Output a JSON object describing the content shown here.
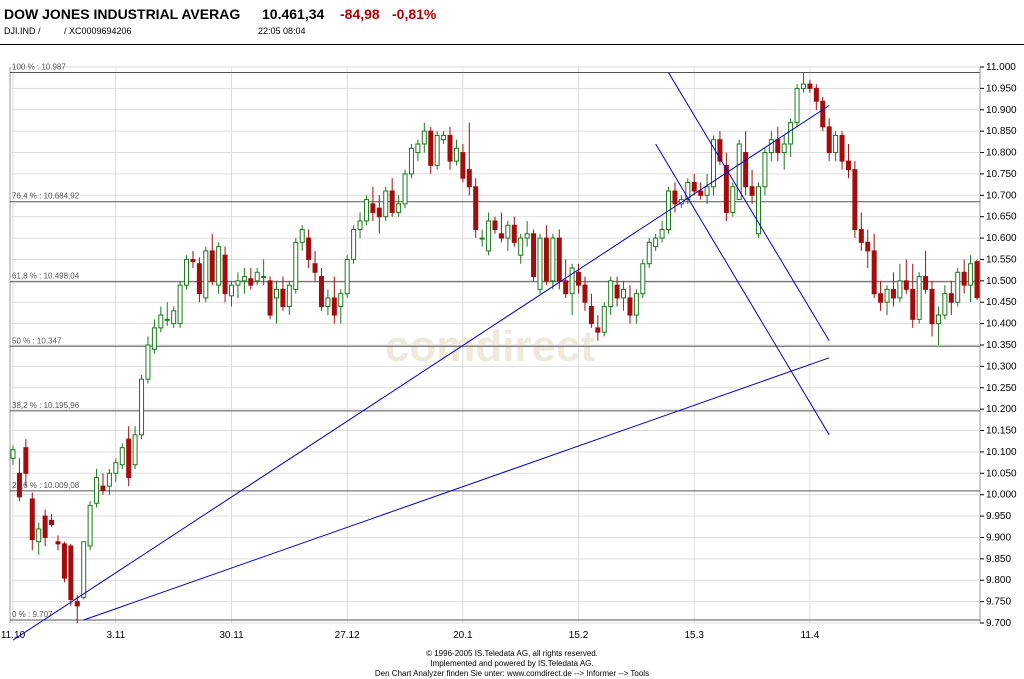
{
  "header": {
    "name": "DOW JONES INDUSTRIAL AVERAG",
    "price": "10.461,34",
    "change": "-84,98",
    "change_pct": "-0,81%",
    "symbol": "DJI.IND  /",
    "isin": "/  XC0009694206",
    "time": "22:05   08:04"
  },
  "watermark": "comdirect",
  "footer": {
    "line1": "© 1996-2005 IS.Teledata AG, all rights reserved.",
    "line2": "Implemented and powered by IS.Teledata AG.",
    "line3": "Den Chart Analyzer finden Sie unter: www.comdirect.de --> Informer --> Tools"
  },
  "colors": {
    "up": "#1a7a1a",
    "down": "#a30d0d",
    "trendline": "#0000cc",
    "grid": "#dddddd",
    "change": "#b00000"
  },
  "chart_data": {
    "type": "candlestick",
    "title": "",
    "ylim": [
      9700,
      11000
    ],
    "y_ticks": [
      "11.000",
      "10.950",
      "10.900",
      "10.850",
      "10.800",
      "10.750",
      "10.700",
      "10.650",
      "10.600",
      "10.550",
      "10.500",
      "10.450",
      "10.400",
      "10.350",
      "10.300",
      "10.250",
      "10.200",
      "10.150",
      "10.100",
      "10.050",
      "10.000",
      "9.950",
      "9.900",
      "9.850",
      "9.800",
      "9.750",
      "9.700"
    ],
    "x_ticks": [
      {
        "label": "11.10",
        "index": 0
      },
      {
        "label": "3.11",
        "index": 16
      },
      {
        "label": "30.11",
        "index": 34
      },
      {
        "label": "27.12",
        "index": 52
      },
      {
        "label": "20.1",
        "index": 70
      },
      {
        "label": "15.2",
        "index": 88
      },
      {
        "label": "15.3",
        "index": 106
      },
      {
        "label": "11.4",
        "index": 124
      }
    ],
    "fibonacci": [
      {
        "label": "100 % : 10.987",
        "value": 10987
      },
      {
        "label": "76,4 % : 10.684,92",
        "value": 10685
      },
      {
        "label": "61,8 % : 10.498,04",
        "value": 10498
      },
      {
        "label": "50 % : 10.347",
        "value": 10347
      },
      {
        "label": "38,2 % : 10.195,96",
        "value": 10196
      },
      {
        "label": "23,6 % : 10.009,08",
        "value": 10009
      },
      {
        "label": "0 % : 9.707",
        "value": 9707
      }
    ],
    "trendlines": [
      {
        "x1": 0.0,
        "y1": 9660,
        "x2": 127.0,
        "y2": 10910
      },
      {
        "x1": 11.0,
        "y1": 9707,
        "x2": 127.0,
        "y2": 10320
      },
      {
        "x1": 102.0,
        "y1": 10987,
        "x2": 127.0,
        "y2": 10360
      },
      {
        "x1": 100.0,
        "y1": 10820,
        "x2": 127.0,
        "y2": 10140
      }
    ],
    "candles": [
      [
        10085,
        10115,
        10070,
        10105
      ],
      [
        10050,
        10085,
        9985,
        9995
      ],
      [
        10110,
        10130,
        10020,
        10050
      ],
      [
        9990,
        10005,
        9870,
        9895
      ],
      [
        9890,
        9935,
        9860,
        9920
      ],
      [
        9950,
        9965,
        9880,
        9900
      ],
      [
        9940,
        9955,
        9925,
        9930
      ],
      [
        9890,
        9905,
        9870,
        9885
      ],
      [
        9885,
        9890,
        9795,
        9805
      ],
      [
        9880,
        9885,
        9740,
        9755
      ],
      [
        9750,
        9765,
        9700,
        9740
      ],
      [
        9760,
        9890,
        9755,
        9890
      ],
      [
        9880,
        9985,
        9870,
        9975
      ],
      [
        9980,
        10060,
        9970,
        10040
      ],
      [
        10020,
        10050,
        10000,
        10010
      ],
      [
        10020,
        10060,
        10000,
        10050
      ],
      [
        10050,
        10085,
        10030,
        10075
      ],
      [
        10070,
        10120,
        10060,
        10110
      ],
      [
        10130,
        10160,
        10020,
        10040
      ],
      [
        10070,
        10160,
        10060,
        10140
      ],
      [
        10140,
        10280,
        10130,
        10270
      ],
      [
        10270,
        10370,
        10260,
        10350
      ],
      [
        10340,
        10410,
        10330,
        10390
      ],
      [
        10390,
        10440,
        10380,
        10420
      ],
      [
        10410,
        10450,
        10395,
        10410
      ],
      [
        10400,
        10440,
        10390,
        10430
      ],
      [
        10400,
        10500,
        10390,
        10490
      ],
      [
        10490,
        10560,
        10480,
        10550
      ],
      [
        10550,
        10570,
        10530,
        10545
      ],
      [
        10540,
        10555,
        10450,
        10470
      ],
      [
        10460,
        10580,
        10450,
        10570
      ],
      [
        10570,
        10610,
        10490,
        10500
      ],
      [
        10490,
        10590,
        10470,
        10580
      ],
      [
        10560,
        10580,
        10450,
        10470
      ],
      [
        10465,
        10500,
        10440,
        10490
      ],
      [
        10490,
        10520,
        10460,
        10500
      ],
      [
        10500,
        10530,
        10470,
        10510
      ],
      [
        10505,
        10530,
        10480,
        10490
      ],
      [
        10500,
        10530,
        10490,
        10520
      ],
      [
        10510,
        10550,
        10490,
        10510
      ],
      [
        10500,
        10510,
        10410,
        10420
      ],
      [
        10460,
        10500,
        10400,
        10480
      ],
      [
        10480,
        10510,
        10430,
        10440
      ],
      [
        10440,
        10500,
        10420,
        10490
      ],
      [
        10480,
        10600,
        10470,
        10590
      ],
      [
        10590,
        10630,
        10570,
        10620
      ],
      [
        10600,
        10620,
        10530,
        10550
      ],
      [
        10540,
        10570,
        10500,
        10520
      ],
      [
        10510,
        10530,
        10430,
        10440
      ],
      [
        10440,
        10480,
        10420,
        10460
      ],
      [
        10460,
        10510,
        10400,
        10420
      ],
      [
        10440,
        10480,
        10400,
        10470
      ],
      [
        10470,
        10560,
        10460,
        10550
      ],
      [
        10550,
        10630,
        10540,
        10620
      ],
      [
        10620,
        10660,
        10600,
        10640
      ],
      [
        10640,
        10700,
        10630,
        10690
      ],
      [
        10680,
        10720,
        10640,
        10660
      ],
      [
        10670,
        10700,
        10610,
        10650
      ],
      [
        10650,
        10720,
        10640,
        10710
      ],
      [
        10710,
        10740,
        10650,
        10660
      ],
      [
        10660,
        10700,
        10650,
        10680
      ],
      [
        10680,
        10760,
        10670,
        10750
      ],
      [
        10750,
        10820,
        10740,
        10810
      ],
      [
        10800,
        10830,
        10780,
        10820
      ],
      [
        10820,
        10870,
        10800,
        10850
      ],
      [
        10850,
        10860,
        10750,
        10770
      ],
      [
        10770,
        10850,
        10760,
        10840
      ],
      [
        10830,
        10850,
        10820,
        10840
      ],
      [
        10840,
        10860,
        10760,
        10780
      ],
      [
        10780,
        10830,
        10770,
        10810
      ],
      [
        10800,
        10820,
        10730,
        10740
      ],
      [
        10760,
        10870,
        10700,
        10720
      ],
      [
        10720,
        10740,
        10600,
        10620
      ],
      [
        10600,
        10620,
        10580,
        10600
      ],
      [
        10570,
        10660,
        10560,
        10640
      ],
      [
        10640,
        10650,
        10610,
        10620
      ],
      [
        10610,
        10660,
        10590,
        10600
      ],
      [
        10600,
        10640,
        10570,
        10630
      ],
      [
        10630,
        10650,
        10580,
        10590
      ],
      [
        10560,
        10610,
        10540,
        10600
      ],
      [
        10600,
        10640,
        10580,
        10610
      ],
      [
        10610,
        10620,
        10500,
        10510
      ],
      [
        10480,
        10610,
        10470,
        10600
      ],
      [
        10600,
        10630,
        10490,
        10500
      ],
      [
        10500,
        10610,
        10480,
        10600
      ],
      [
        10600,
        10620,
        10480,
        10500
      ],
      [
        10500,
        10550,
        10460,
        10470
      ],
      [
        10470,
        10540,
        10420,
        10530
      ],
      [
        10520,
        10540,
        10470,
        10490
      ],
      [
        10490,
        10510,
        10430,
        10450
      ],
      [
        10440,
        10470,
        10390,
        10400
      ],
      [
        10390,
        10420,
        10360,
        10380
      ],
      [
        10380,
        10450,
        10370,
        10440
      ],
      [
        10440,
        10510,
        10420,
        10500
      ],
      [
        10490,
        10510,
        10440,
        10460
      ],
      [
        10460,
        10500,
        10430,
        10480
      ],
      [
        10460,
        10490,
        10400,
        10420
      ],
      [
        10420,
        10480,
        10400,
        10470
      ],
      [
        10470,
        10550,
        10460,
        10540
      ],
      [
        10540,
        10600,
        10530,
        10590
      ],
      [
        10580,
        10610,
        10570,
        10600
      ],
      [
        10600,
        10640,
        10590,
        10620
      ],
      [
        10620,
        10720,
        10610,
        10710
      ],
      [
        10710,
        10730,
        10660,
        10680
      ],
      [
        10680,
        10700,
        10670,
        10690
      ],
      [
        10690,
        10740,
        10680,
        10730
      ],
      [
        10730,
        10750,
        10700,
        10710
      ],
      [
        10710,
        10730,
        10690,
        10700
      ],
      [
        10700,
        10750,
        10680,
        10720
      ],
      [
        10720,
        10840,
        10700,
        10830
      ],
      [
        10830,
        10850,
        10770,
        10780
      ],
      [
        10770,
        10800,
        10640,
        10660
      ],
      [
        10660,
        10730,
        10650,
        10720
      ],
      [
        10690,
        10830,
        10690,
        10820
      ],
      [
        10800,
        10850,
        10700,
        10720
      ],
      [
        10720,
        10760,
        10680,
        10700
      ],
      [
        10610,
        10730,
        10600,
        10720
      ],
      [
        10720,
        10810,
        10700,
        10800
      ],
      [
        10800,
        10850,
        10780,
        10830
      ],
      [
        10830,
        10860,
        10780,
        10800
      ],
      [
        10800,
        10840,
        10760,
        10820
      ],
      [
        10820,
        10880,
        10790,
        10870
      ],
      [
        10870,
        10960,
        10860,
        10950
      ],
      [
        10950,
        10987,
        10940,
        10960
      ],
      [
        10960,
        10970,
        10940,
        10950
      ],
      [
        10950,
        10960,
        10900,
        10920
      ],
      [
        10920,
        10930,
        10850,
        10860
      ],
      [
        10860,
        10880,
        10780,
        10800
      ],
      [
        10800,
        10850,
        10780,
        10840
      ],
      [
        10840,
        10850,
        10760,
        10780
      ],
      [
        10780,
        10820,
        10740,
        10760
      ],
      [
        10760,
        10780,
        10600,
        10620
      ],
      [
        10620,
        10660,
        10570,
        10590
      ],
      [
        10590,
        10620,
        10530,
        10570
      ],
      [
        10570,
        10610,
        10460,
        10470
      ],
      [
        10470,
        10500,
        10430,
        10450
      ],
      [
        10450,
        10490,
        10420,
        10480
      ],
      [
        10480,
        10520,
        10440,
        10460
      ],
      [
        10460,
        10540,
        10450,
        10500
      ],
      [
        10500,
        10550,
        10470,
        10480
      ],
      [
        10480,
        10540,
        10390,
        10410
      ],
      [
        10410,
        10520,
        10400,
        10510
      ],
      [
        10510,
        10570,
        10470,
        10480
      ],
      [
        10480,
        10500,
        10370,
        10400
      ],
      [
        10400,
        10440,
        10350,
        10420
      ],
      [
        10420,
        10490,
        10410,
        10470
      ],
      [
        10470,
        10500,
        10420,
        10450
      ],
      [
        10450,
        10530,
        10440,
        10520
      ],
      [
        10520,
        10550,
        10470,
        10490
      ],
      [
        10490,
        10560,
        10450,
        10540
      ],
      [
        10545,
        10550,
        10455,
        10461
      ]
    ]
  }
}
